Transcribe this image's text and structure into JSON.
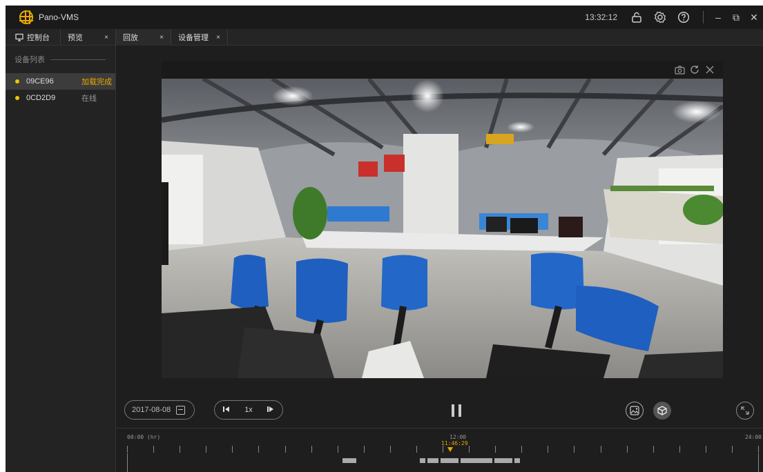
{
  "app": {
    "title": "Pano-VMS",
    "clock": "13:32:12"
  },
  "window_controls": {
    "minimize": "–",
    "restore": "⧉",
    "close": "✕"
  },
  "tabs": [
    {
      "label": "控制台",
      "closable": false
    },
    {
      "label": "预览",
      "closable": true
    },
    {
      "label": "回放",
      "closable": true
    },
    {
      "label": "设备管理",
      "closable": true
    }
  ],
  "tab_close_glyph": "×",
  "sidebar": {
    "heading": "设备列表",
    "devices": [
      {
        "name": "09CE96",
        "status": "加载完成",
        "active": true
      },
      {
        "name": "0CD2D9",
        "status": "在线",
        "active": false
      }
    ]
  },
  "player": {
    "date": "2017-08-08",
    "speed": "1x",
    "icons": [
      "snapshot-icon",
      "refresh-icon",
      "close-icon",
      "play-prev-icon",
      "play-next-icon",
      "pause-icon",
      "image-icon",
      "cube-icon",
      "fullscreen-icon"
    ]
  },
  "timeline": {
    "start_label": "00:00 (hr)",
    "mid_label": "12:00",
    "end_label": "24:00",
    "current_time": "11:46:29",
    "tick_count": 24
  },
  "colors": {
    "accent": "#e8a800",
    "status_online": "#f0c400",
    "background": "#1e1e1e"
  }
}
